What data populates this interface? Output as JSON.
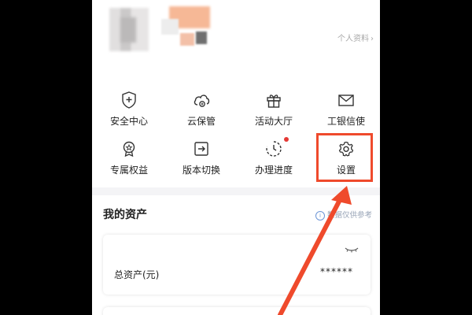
{
  "profile": {
    "link_label": "个人资料",
    "chevron": "›"
  },
  "menu": {
    "items": [
      {
        "label": "安全中心",
        "icon": "shield-plus-icon"
      },
      {
        "label": "云保管",
        "icon": "cloud-icon"
      },
      {
        "label": "活动大厅",
        "icon": "gift-icon"
      },
      {
        "label": "工银信使",
        "icon": "mail-icon"
      },
      {
        "label": "专属权益",
        "icon": "badge-icon"
      },
      {
        "label": "版本切换",
        "icon": "switch-icon"
      },
      {
        "label": "办理进度",
        "icon": "progress-icon",
        "has_dot": true
      },
      {
        "label": "设置",
        "icon": "gear-icon",
        "highlighted": true
      }
    ]
  },
  "assets": {
    "title": "我的资产",
    "note": "数据仅供参考",
    "info_glyph": "i",
    "total_label": "总资产(元)",
    "total_value": "******"
  },
  "colors": {
    "highlight": "#ef4a2c",
    "icon": "#333333",
    "notification_dot": "#e53935"
  }
}
